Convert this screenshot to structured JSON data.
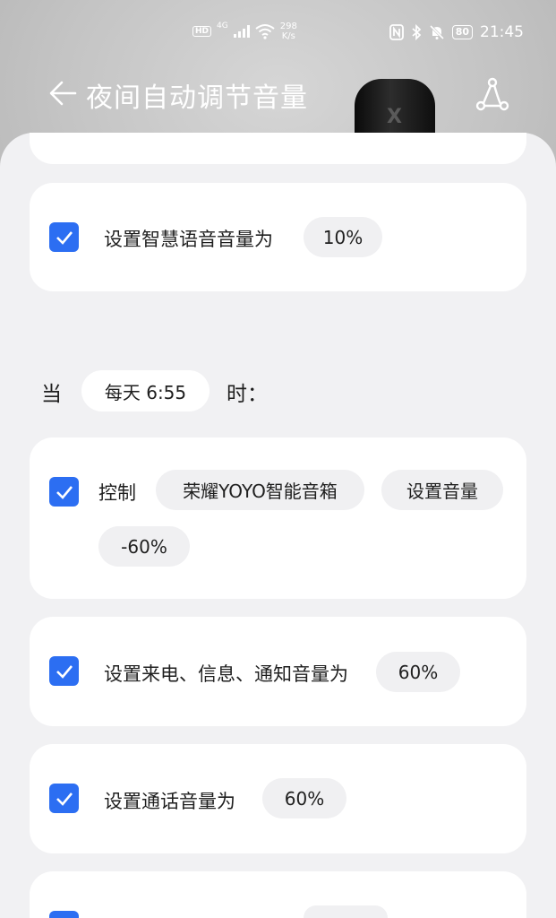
{
  "status_bar": {
    "hd": "HD",
    "network": "4G",
    "speed_value": "298",
    "speed_unit": "K/s",
    "battery": "80",
    "time": "21:45"
  },
  "app_bar": {
    "title": "夜间自动调节音量"
  },
  "icons": {
    "back": "back-arrow-icon",
    "share": "share-route-icon",
    "check": "checkmark-icon"
  },
  "colors": {
    "accent": "#2c6ef2",
    "card": "#ffffff",
    "pill": "#f0f0f2",
    "background": "#f1f1f3"
  },
  "top_card": {
    "label": "设置智慧语音音量为",
    "value": "10%"
  },
  "condition": {
    "prefix": "当",
    "time": "每天 6:55",
    "suffix": "时："
  },
  "actions": [
    {
      "verb": "控制",
      "device": "荣耀YOYO智能音箱",
      "operation": "设置音量",
      "value": "-60%"
    },
    {
      "label": "设置来电、信息、通知音量为",
      "value": "60%"
    },
    {
      "label": "设置通话音量为",
      "value": "60%"
    }
  ]
}
